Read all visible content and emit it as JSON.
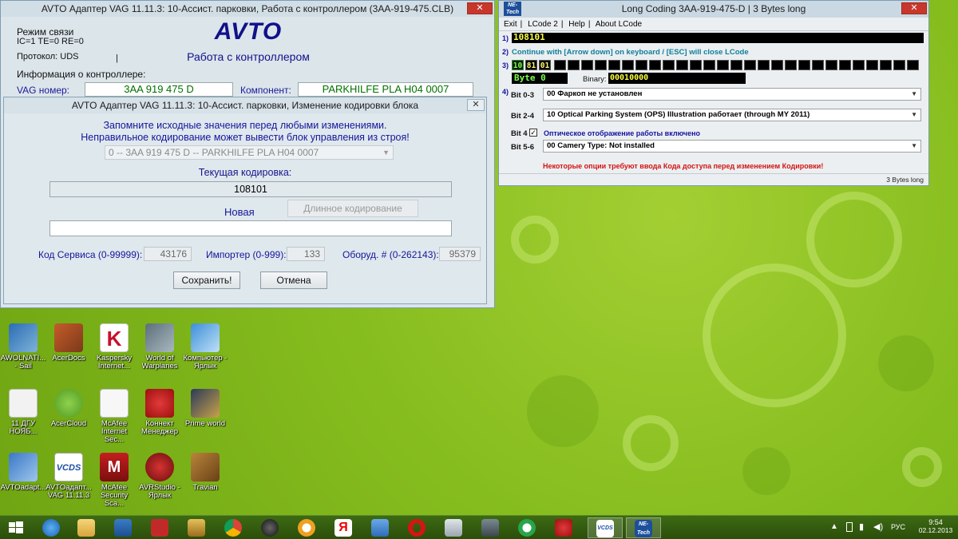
{
  "avto_main": {
    "title": "AVTO Адаптер VAG 11.11.3: 10-Ассист. парковки,  Работа с контроллером (3AA-919-475.CLB)",
    "close": "✕",
    "mode_label": "Режим связи",
    "mode_values": "IC=1  TE=0   RE=0",
    "protocol": "Протокол: UDS",
    "logo": "AVTO",
    "subtitle": "Работа с контроллером",
    "info_label": "Информация о контроллере:",
    "vag_label": "VAG номер:",
    "vag_value": "3AA 919 475 D",
    "comp_label": "Компонент:",
    "comp_value": "PARKHILFE PLA H04 0007"
  },
  "coding_dialog": {
    "title": "AVTO Адаптер VAG 11.11.3: 10-Ассист. парковки,  Изменение кодировки блока",
    "close": "✕",
    "warning_1": "Запомните исходные значения перед любыми изменениями.",
    "warning_2": "Неправильное кодирование может вывести блок управления из строя!",
    "module_select": "0 -- 3AA 919 475 D -- PARKHILFE PLA H04 0007",
    "current_label": "Текущая кодировка:",
    "current_value": "108101",
    "new_label": "Новая",
    "new_value": "",
    "long_coding_button": "Длинное кодирование",
    "service_label": "Код Сервиса (0-99999):",
    "service_value": "43176",
    "importer_label": "Импортер (0-999):",
    "importer_value": "133",
    "equip_label": "Оборуд. # (0-262143):",
    "equip_value": "95379",
    "save_button": "Сохранить!",
    "cancel_button": "Отмена"
  },
  "long_coding": {
    "icon_text": "NE-Tech",
    "title": "Long Coding  3AA-919-475-D | 3 Bytes long",
    "close": "✕",
    "menu": [
      "Exit",
      "LCode 2",
      "Help",
      "About LCode"
    ],
    "step1": "1)",
    "code": "108101",
    "step2": "2)",
    "hint": "Continue with [Arrow down] on keyboard / [ESC] will close LCode",
    "step3": "3)",
    "bytes": [
      "10",
      "81",
      "01"
    ],
    "byte_label": "Byte 0",
    "binary_label": "Binary:",
    "binary_value": "00010000",
    "step4": "4)",
    "bit03_label": "Bit 0-3",
    "bit03_value": "00 Фаркоп не установлен",
    "bit24_label": "Bit 2-4",
    "bit24_value": "10 Optical Parking System (OPS) Illustration работает (through MY 2011)",
    "bit4_label": "Bit 4",
    "bit4_checked": "✓",
    "bit4_text": "Оптическое отображение работы включено",
    "bit56_label": "Bit 5-6",
    "bit56_value": "00 Camery Type: Not installed",
    "warning": "Некоторые опции требуют ввода Кода доступа перед изменением Кодировки!",
    "status": "3 Bytes long"
  },
  "desktop_icons": [
    "AWOLNATI... - Sail",
    "AcerDocs",
    "Kaspersky Internet...",
    "World of Warplanes",
    "Компьютер - Ярлык",
    "11 ДГУ НОЯБ...",
    "AcerCloud",
    "McAfee Internet Sec...",
    "Коннект Менеджер",
    "Prime world",
    "AVTOadapt...",
    "AVTOадапт... VAG 11.11.3",
    "McAfee Security Sca...",
    "AVRStudio - Ярлык",
    "Travian"
  ],
  "tray": {
    "lang": "РУС",
    "time": "9:54",
    "date": "02.12.2013"
  }
}
